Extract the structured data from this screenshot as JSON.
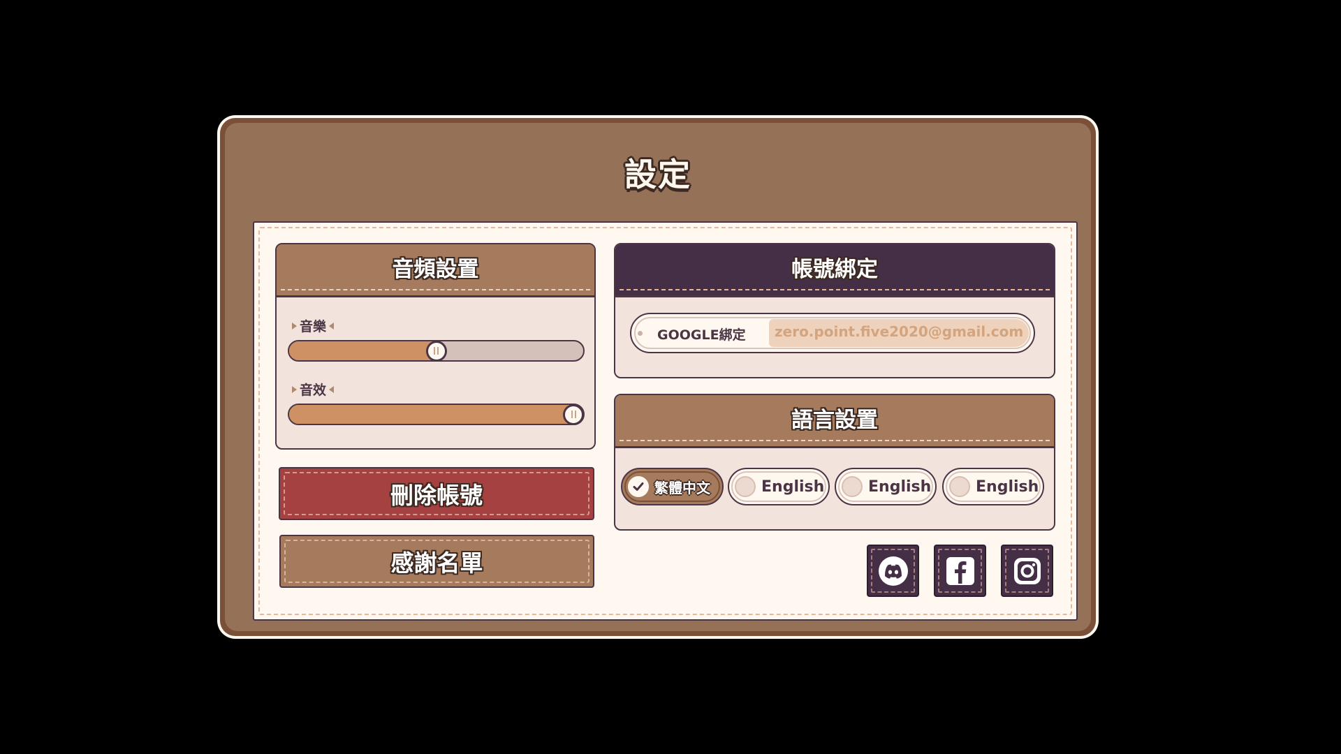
{
  "settings": {
    "title": "設定",
    "audio": {
      "title": "音頻設置",
      "music_label": "音樂",
      "music_level": 0.5,
      "sfx_label": "音效",
      "sfx_level": 1.0
    },
    "delete_account_label": "刪除帳號",
    "credits_label": "感謝名單",
    "account": {
      "title": "帳號綁定",
      "google_label": "GOOGLE綁定",
      "google_email": "zero.point.five2020@gmail.com"
    },
    "language": {
      "title": "語言設置",
      "options": [
        {
          "label": "繁體中文",
          "selected": true
        },
        {
          "label": "English",
          "selected": false
        },
        {
          "label": "English",
          "selected": false
        },
        {
          "label": "English",
          "selected": false
        }
      ]
    },
    "social_icons": [
      "discord-icon",
      "facebook-icon",
      "instagram-icon"
    ]
  },
  "colors": {
    "frame": "#957158",
    "paper": "#fff8f1",
    "outline": "#4b3545",
    "header_brown": "#a67b5d",
    "header_purple": "#452f47",
    "slider_fill": "#cd9163",
    "delete_red": "#a54141"
  }
}
